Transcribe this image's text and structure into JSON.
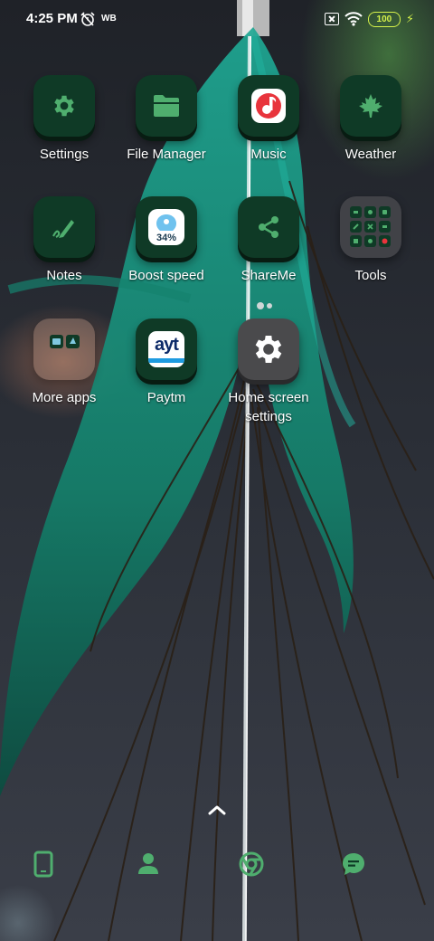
{
  "status_bar": {
    "time": "4:25 PM",
    "carrier_badge": "WB",
    "battery_level": "100",
    "icons": [
      "alarm-off-icon",
      "sim-disabled-icon",
      "wifi-icon",
      "battery-icon",
      "charging-bolt-icon"
    ]
  },
  "apps": [
    {
      "label": "Settings",
      "icon": "gear-icon"
    },
    {
      "label": "File Manager",
      "icon": "folder-icon"
    },
    {
      "label": "Music",
      "icon": "music-note-icon"
    },
    {
      "label": "Weather",
      "icon": "maple-leaf-icon"
    },
    {
      "label": "Notes",
      "icon": "pen-icon"
    },
    {
      "label": "Boost speed",
      "icon": "boost-speed-icon",
      "badge": "34%"
    },
    {
      "label": "ShareMe",
      "icon": "share-icon"
    },
    {
      "label": "Tools",
      "icon": "tools-folder-icon"
    },
    {
      "label": "More apps",
      "icon": "more-apps-folder-icon"
    },
    {
      "label": "Paytm",
      "icon": "paytm-logo-icon",
      "logo_text": "ayt"
    },
    {
      "label": "Home screen settings",
      "label_line1": "Home screen",
      "label_line2": "settings",
      "icon": "gear-icon"
    }
  ],
  "dock": [
    {
      "name": "phone",
      "icon": "phone-icon"
    },
    {
      "name": "contacts",
      "icon": "contacts-icon"
    },
    {
      "name": "browser",
      "icon": "chrome-icon"
    },
    {
      "name": "messages",
      "icon": "messages-icon"
    }
  ],
  "colors": {
    "icon_background": "#0f3a26",
    "icon_glyph": "#4fae6e",
    "battery_accent": "#d6f24a",
    "music_red": "#e8343c"
  }
}
